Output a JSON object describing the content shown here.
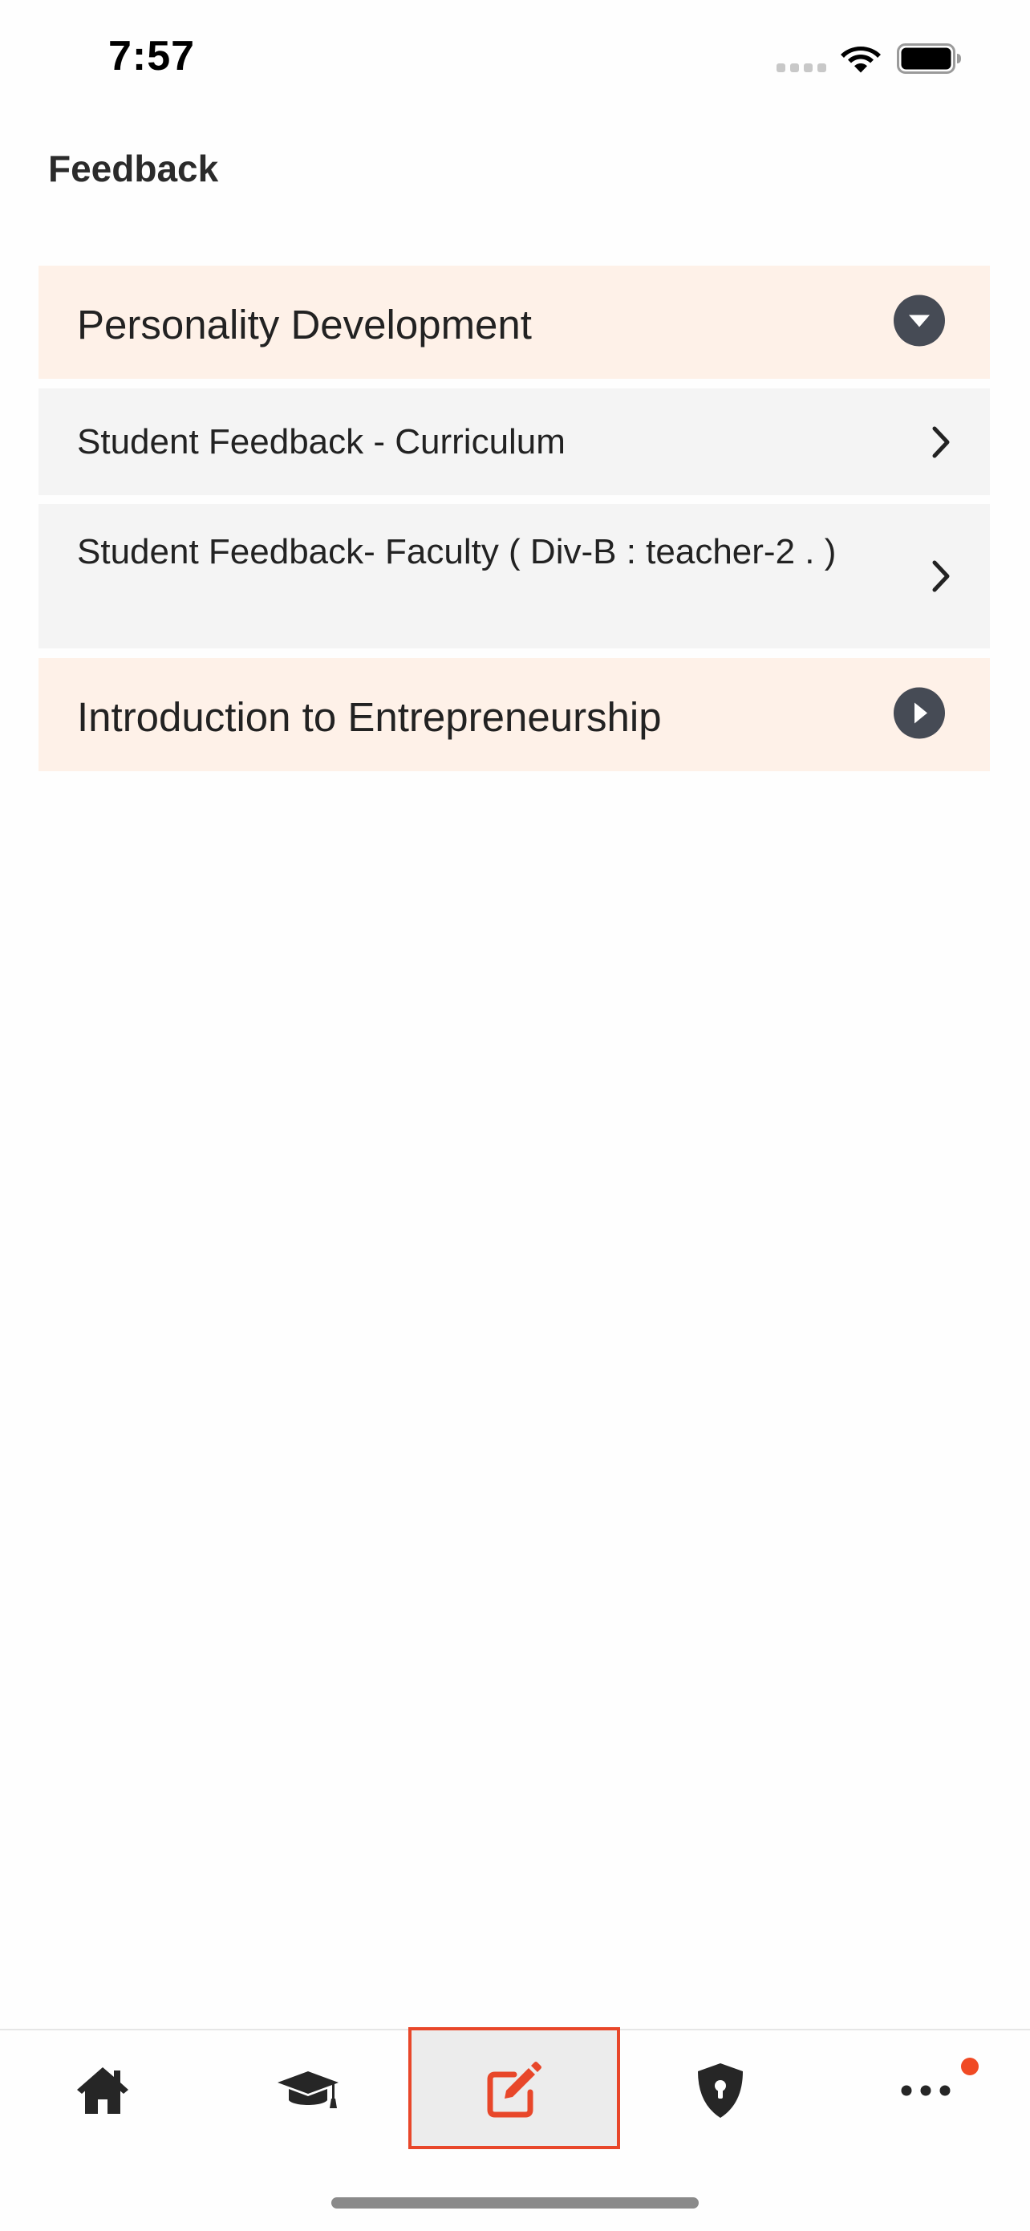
{
  "status_bar": {
    "time": "7:57",
    "icons": [
      "cellular-signal-icon",
      "wifi-icon",
      "battery-icon"
    ]
  },
  "header": {
    "title": "Feedback"
  },
  "courses": [
    {
      "title": "Personality Development",
      "expanded": true,
      "toggle_icon": "caret-down-circle-icon",
      "items": [
        {
          "label": "Student Feedback - Curriculum",
          "icon": "chevron-right-icon"
        },
        {
          "label": "Student Feedback- Faculty ( Div-B : teacher-2 . )",
          "icon": "chevron-right-icon"
        }
      ]
    },
    {
      "title": "Introduction to Entrepreneurship",
      "expanded": false,
      "toggle_icon": "caret-right-circle-icon",
      "items": []
    }
  ],
  "tab_bar": {
    "tabs": [
      {
        "icon": "home-icon",
        "active": false
      },
      {
        "icon": "graduation-cap-icon",
        "active": false
      },
      {
        "icon": "edit-icon",
        "active": true
      },
      {
        "icon": "shield-lock-icon",
        "active": false
      },
      {
        "icon": "more-dots-icon",
        "active": false,
        "notification_badge": true
      }
    ]
  },
  "colors": {
    "course_row_bg": "#fef1e8",
    "item_row_bg": "#f4f4f4",
    "accent": "#e8472a",
    "icon_dark": "#464b55",
    "badge": "#f04a24"
  }
}
